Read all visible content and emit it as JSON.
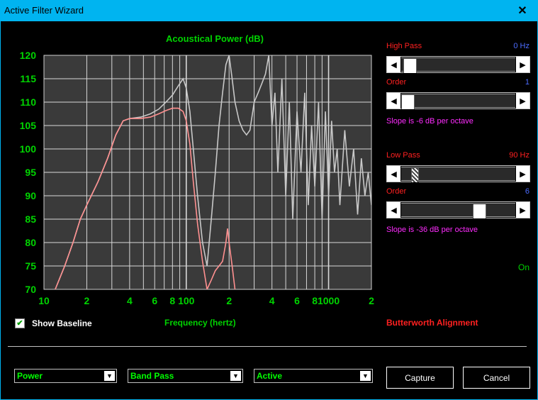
{
  "window": {
    "title": "Active Filter Wizard",
    "close_glyph": "✕"
  },
  "colors": {
    "titlebar": "#00b4f0",
    "green": "#00d400",
    "red": "#ff2020",
    "blue": "#4c6cff",
    "magenta": "#ff2cff",
    "plot_bg": "#3a3a3a",
    "raw_curve": "#c8c8c8",
    "filtered_curve": "#ff9090"
  },
  "high_pass": {
    "label": "High Pass",
    "value": "0 Hz",
    "order_label": "Order",
    "order_value": "1",
    "slope_text": "Slope is -6 dB per octave",
    "slider_fraction": 0.02,
    "order_fraction": 0.0
  },
  "low_pass": {
    "label": "Low Pass",
    "value": "90 Hz",
    "order_label": "Order",
    "order_value": "6",
    "slope_text": "Slope is -36 dB per octave",
    "slider_fraction": 0.09,
    "order_fraction": 0.71
  },
  "status": {
    "on_text": "On",
    "alignment_text": "Butterworth Alignment"
  },
  "baseline": {
    "label": "Show Baseline",
    "checked": true
  },
  "combos": {
    "response": "Power",
    "filter_type": "Band Pass",
    "mode": "Active"
  },
  "buttons": {
    "capture": "Capture",
    "cancel": "Cancel"
  },
  "chart_data": {
    "type": "line",
    "title": "Acoustical Power (dB)",
    "xlabel": "Frequency (hertz)",
    "ylabel": "",
    "x_scale": "log",
    "xlim": [
      10,
      2000
    ],
    "ylim": [
      70,
      120
    ],
    "y_ticks": [
      70,
      75,
      80,
      85,
      90,
      95,
      100,
      105,
      110,
      115,
      120
    ],
    "x_tick_labels": [
      {
        "x": 10,
        "label": "10"
      },
      {
        "x": 20,
        "label": "2"
      },
      {
        "x": 40,
        "label": "4"
      },
      {
        "x": 60,
        "label": "6"
      },
      {
        "x": 80,
        "label": "8"
      },
      {
        "x": 100,
        "label": "100"
      },
      {
        "x": 200,
        "label": "2"
      },
      {
        "x": 400,
        "label": "4"
      },
      {
        "x": 600,
        "label": "6"
      },
      {
        "x": 800,
        "label": "8"
      },
      {
        "x": 1000,
        "label": "1000"
      },
      {
        "x": 2000,
        "label": "2"
      }
    ],
    "grid": true,
    "series": [
      {
        "key": "raw",
        "x": [
          12,
          14,
          16,
          18,
          20,
          24,
          28,
          32,
          36,
          40,
          48,
          56,
          64,
          72,
          80,
          88,
          95,
          100,
          106,
          112,
          120,
          130,
          140,
          150,
          160,
          170,
          180,
          190,
          200,
          210,
          220,
          235,
          250,
          265,
          280,
          300,
          320,
          340,
          360,
          380,
          400,
          420,
          440,
          470,
          500,
          530,
          560,
          600,
          640,
          680,
          720,
          760,
          800,
          850,
          900,
          950,
          1000,
          1050,
          1100,
          1150,
          1200,
          1300,
          1400,
          1500,
          1600,
          1700,
          1800,
          1900,
          2000
        ],
        "y": [
          70,
          75,
          80,
          85,
          88,
          93,
          98,
          103,
          106,
          106.5,
          106.8,
          107.5,
          108.5,
          110,
          111.5,
          113.5,
          115,
          113,
          108,
          100,
          90,
          80,
          75,
          85,
          95,
          105,
          112,
          118,
          120,
          115,
          110,
          106,
          104,
          103,
          104,
          110,
          112,
          114,
          116,
          120,
          105,
          112,
          95,
          115,
          90,
          110,
          85,
          108,
          95,
          112,
          88,
          105,
          92,
          110,
          85,
          108,
          90,
          106,
          95,
          100,
          88,
          104,
          92,
          100,
          86,
          98,
          90,
          95,
          88
        ]
      },
      {
        "key": "filtered",
        "x": [
          12,
          14,
          16,
          18,
          20,
          24,
          28,
          32,
          36,
          40,
          48,
          56,
          64,
          72,
          80,
          88,
          95,
          100,
          106,
          112,
          120,
          130,
          140,
          150,
          160,
          170,
          180,
          190,
          195,
          200,
          210,
          220
        ],
        "y": [
          70,
          75,
          80,
          85,
          88,
          93,
          98,
          103,
          106,
          106.5,
          106.5,
          106.8,
          107.5,
          108.2,
          108.7,
          108.7,
          108,
          106,
          101,
          93,
          84,
          76,
          70,
          72,
          74,
          75,
          76,
          80,
          83,
          80,
          75,
          70
        ]
      }
    ]
  }
}
